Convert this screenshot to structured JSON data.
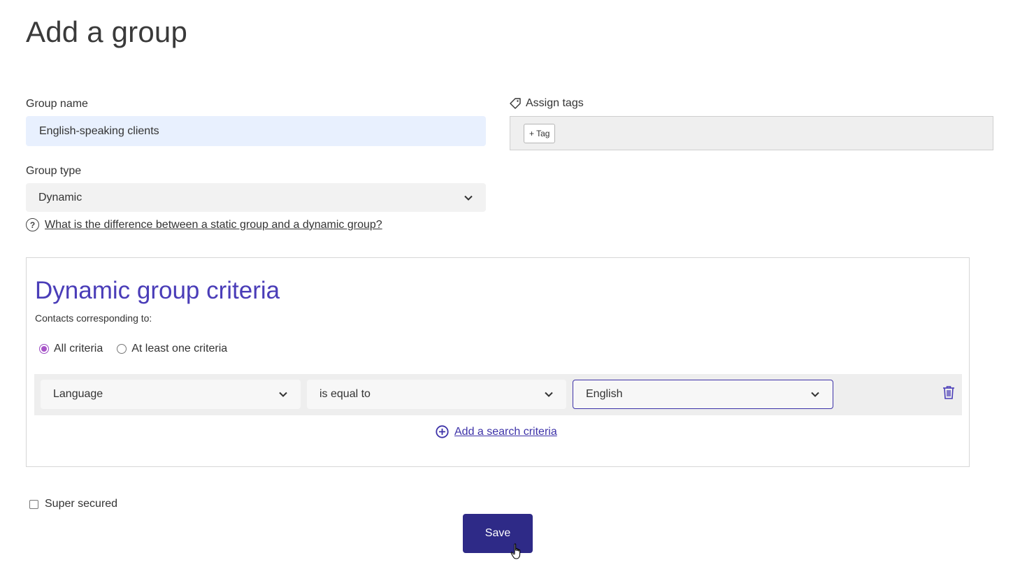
{
  "page": {
    "title": "Add a group"
  },
  "group_name": {
    "label": "Group name",
    "value": "English-speaking clients"
  },
  "group_type": {
    "label": "Group type",
    "selected": "Dynamic",
    "help_link": "What is the difference between a static group and a dynamic group?"
  },
  "tags": {
    "label": "Assign tags",
    "add_button": "+ Tag"
  },
  "criteria": {
    "title": "Dynamic group criteria",
    "subtitle": "Contacts corresponding to:",
    "match_options": [
      {
        "label": "All criteria",
        "checked": true
      },
      {
        "label": "At least one criteria",
        "checked": false
      }
    ],
    "rows": [
      {
        "field": "Language",
        "operator": "is equal to",
        "value": "English"
      }
    ],
    "add_link": "Add a search criteria"
  },
  "super_secured": {
    "label": "Super secured",
    "checked": false
  },
  "save_button": "Save",
  "colors": {
    "accent": "#4a3db8",
    "primary_button": "#2e2a87",
    "radio_checked": "#a855c9",
    "input_highlight": "#e8f0fe"
  },
  "icons": [
    "tag-icon",
    "help-icon",
    "chevron-down-icon",
    "trash-icon",
    "plus-circle-icon",
    "pointer-cursor-icon"
  ]
}
